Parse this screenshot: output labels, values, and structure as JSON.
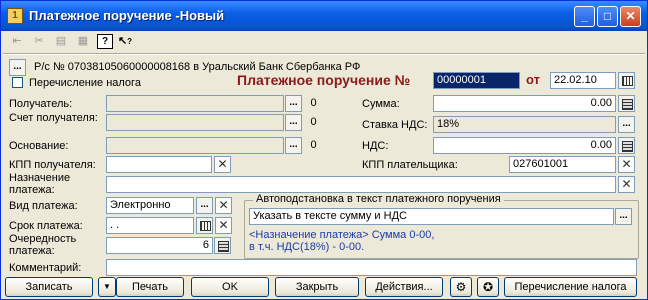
{
  "window": {
    "title": "Платежное поручение -Новый"
  },
  "title_buttons": {
    "minimize": "_",
    "maximize": "□",
    "close": "✕"
  },
  "toolbar": {
    "help_label": "?",
    "whatsthis_label": "?"
  },
  "account": {
    "label": "Р/с № 07038105060000008168 в Уральский Банк Сбербанка РФ",
    "button": "..."
  },
  "tax_transfer": {
    "label": "Перечисление налога",
    "checked": false
  },
  "doc": {
    "title": "Платежное поручение №",
    "number": "00000001",
    "date_label": "от",
    "date": "22.02.10"
  },
  "left": {
    "recipient_label": "Получатель:",
    "account_label": "Счет получателя:",
    "basis_label": "Основание:",
    "kpp_recipient_label": "КПП получателя:",
    "purpose_label": "Назначение платежа:",
    "payment_type_label": "Вид платежа:",
    "payment_type_value": "Электронно",
    "due_label": "Срок платежа:",
    "due_value": ". .",
    "priority_label": "Очередность платежа:",
    "priority_value": "6",
    "comment_label": "Комментарий:"
  },
  "right": {
    "sum_label": "Сумма:",
    "sum_value": "0.00",
    "vat_rate_label": "Ставка НДС:",
    "vat_rate_value": "18%",
    "vat_label": "НДС:",
    "vat_value": "0.00",
    "kpp_payer_label": "КПП плательщика:",
    "kpp_payer_value": "027601001"
  },
  "autofill": {
    "title": "Автоподстановка в текст платежного поручения",
    "select_value": "Указать в тексте сумму и НДС",
    "preview_line1": "<Назначение платежа> Сумма 0-00,",
    "preview_line2": "в т.ч. НДС(18%) - 0-00."
  },
  "small": {
    "dots": "...",
    "o": "0",
    "x": "✕"
  },
  "buttons": {
    "record": "Записать",
    "dropdown": "▼",
    "print": "Печать",
    "ok": "OK",
    "close": "Закрыть",
    "actions": "Действия...",
    "tax_transfer": "Перечисление налога"
  }
}
